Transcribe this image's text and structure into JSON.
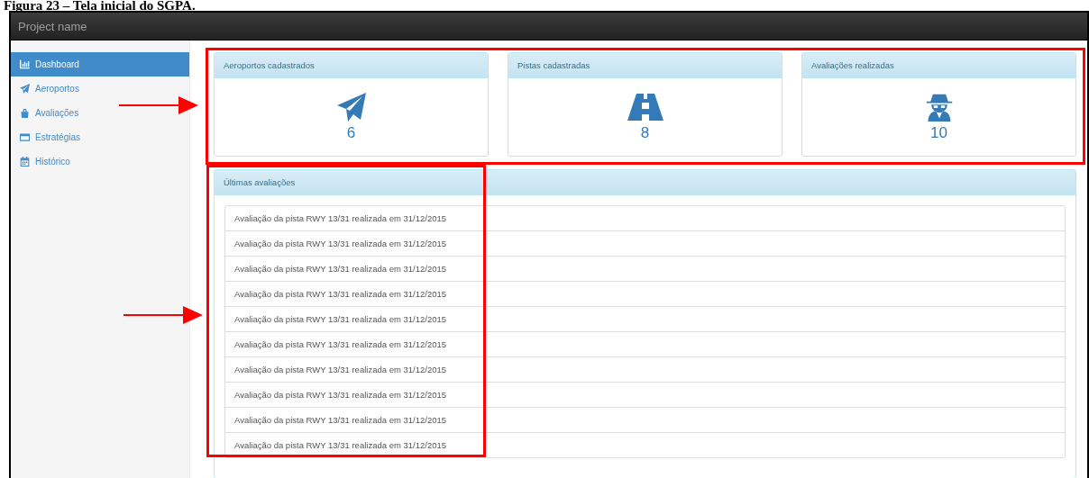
{
  "caption": "Figura 23 – Tela inicial do SGPA.",
  "navbar": {
    "brand": "Project name"
  },
  "sidebar": {
    "items": [
      {
        "label": "Dashboard",
        "selected": true
      },
      {
        "label": "Aeroportos",
        "selected": false
      },
      {
        "label": "Avaliações",
        "selected": false
      },
      {
        "label": "Estratégias",
        "selected": false
      },
      {
        "label": "Histórico",
        "selected": false
      }
    ]
  },
  "stats": [
    {
      "title": "Aeroportos cadastrados",
      "value": "6"
    },
    {
      "title": "Pistas cadastradas",
      "value": "8"
    },
    {
      "title": "Avaliações realizadas",
      "value": "10"
    }
  ],
  "recent": {
    "title": "Últimas avaliações",
    "items": [
      "Avaliação da pista RWY 13/31 realizada em 31/12/2015",
      "Avaliação da pista RWY 13/31 realizada em 31/12/2015",
      "Avaliação da pista RWY 13/31 realizada em 31/12/2015",
      "Avaliação da pista RWY 13/31 realizada em 31/12/2015",
      "Avaliação da pista RWY 13/31 realizada em 31/12/2015",
      "Avaliação da pista RWY 13/31 realizada em 31/12/2015",
      "Avaliação da pista RWY 13/31 realizada em 31/12/2015",
      "Avaliação da pista RWY 13/31 realizada em 31/12/2015",
      "Avaliação da pista RWY 13/31 realizada em 31/12/2015",
      "Avaliação da pista RWY 13/31 realizada em 31/12/2015"
    ]
  },
  "annotations": [
    {
      "kind": "box"
    },
    {
      "kind": "box"
    },
    {
      "kind": "arrow"
    },
    {
      "kind": "arrow"
    }
  ]
}
